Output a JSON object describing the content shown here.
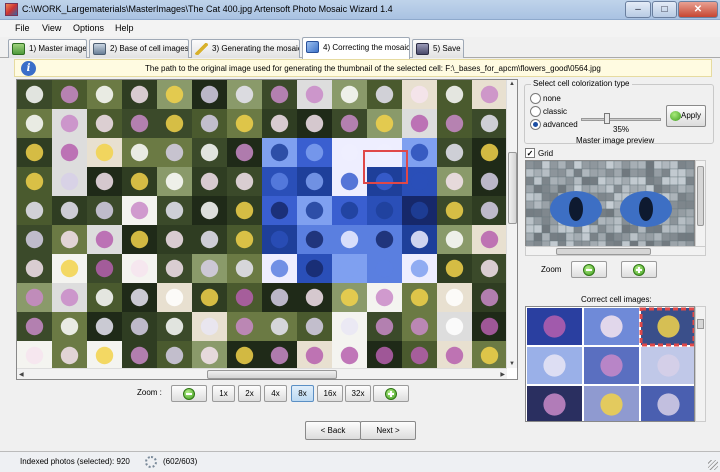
{
  "window": {
    "title": "C:\\WORK_Largematerials\\MasterImages\\The Cat 400.jpg Artensoft Photo Mosaic Wizard 1.4",
    "minimize": "‒",
    "maximize": "□",
    "close": "✕"
  },
  "menu": [
    {
      "label": "File"
    },
    {
      "label": "View"
    },
    {
      "label": "Options"
    },
    {
      "label": "Help"
    }
  ],
  "tabs": [
    {
      "label": "1) Master image",
      "icon": "image-icon",
      "color": "#4f9a3b"
    },
    {
      "label": "2) Base of cell images",
      "icon": "database-icon",
      "color": "#6a7f96"
    },
    {
      "label": "3) Generating the mosaic",
      "icon": "magic-wand-icon",
      "color": "#d8b12b"
    },
    {
      "label": "4) Correcting the mosaic",
      "icon": "cube-icon",
      "color": "#3f73c8",
      "active": true
    },
    {
      "label": "5) Save",
      "icon": "floppy-icon",
      "color": "#4a4a6a"
    }
  ],
  "info": {
    "icon": "info-icon",
    "text": "The path to the original image used for generating the thumbnail of the selected cell: F:\\_bases_for_apcm\\flowers_good\\0564.jpg"
  },
  "zoom": {
    "label": "Zoom :",
    "zoom_out_icon": "zoom-out-icon",
    "zoom_in_icon": "zoom-in-icon",
    "levels": [
      "1x",
      "2x",
      "4x",
      "8x",
      "16x",
      "32x"
    ],
    "selected": "8x"
  },
  "navigation": {
    "back": "< Back",
    "next": "Next >"
  },
  "colorization": {
    "title": "Select cell colorization type",
    "options": [
      "none",
      "classic",
      "advanced"
    ],
    "selected": "advanced",
    "level_percent": 35,
    "level_label": "35%",
    "apply": "Apply"
  },
  "preview": {
    "title": "Master image preview",
    "grid_label": "Grid",
    "grid_checked": true,
    "zoom_label": "Zoom"
  },
  "cells": {
    "title": "Correct cell images:"
  },
  "status": {
    "indexed": "Indexed photos (selected): 920",
    "progress": "(602/603)"
  },
  "colors": {
    "selection": "#e04848",
    "accent": "#3f73c8"
  }
}
